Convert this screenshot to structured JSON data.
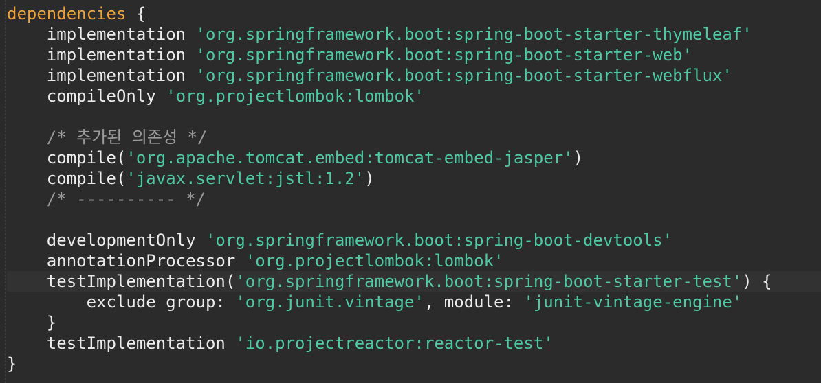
{
  "editor": {
    "language": "groovy",
    "colors": {
      "background": "#2b2b2b",
      "identifier": "#ebebeb",
      "string": "#4ec9a3",
      "comment": "#9a9a9a",
      "keyword": "#f0a23a"
    },
    "lines": [
      {
        "indent": "",
        "tokens": [
          {
            "type": "keyword",
            "text": "dependencies"
          },
          {
            "type": "punct",
            "text": " {"
          }
        ]
      },
      {
        "indent": "    ",
        "tokens": [
          {
            "type": "id",
            "text": "implementation "
          },
          {
            "type": "str",
            "text": "'org.springframework.boot:spring-boot-starter-thymeleaf'"
          }
        ]
      },
      {
        "indent": "    ",
        "tokens": [
          {
            "type": "id",
            "text": "implementation "
          },
          {
            "type": "str",
            "text": "'org.springframework.boot:spring-boot-starter-web'"
          }
        ]
      },
      {
        "indent": "    ",
        "tokens": [
          {
            "type": "id",
            "text": "implementation "
          },
          {
            "type": "str",
            "text": "'org.springframework.boot:spring-boot-starter-webflux'"
          }
        ]
      },
      {
        "indent": "    ",
        "tokens": [
          {
            "type": "id",
            "text": "compileOnly "
          },
          {
            "type": "str",
            "text": "'org.projectlombok:lombok'"
          }
        ]
      },
      {
        "indent": "",
        "tokens": []
      },
      {
        "indent": "    ",
        "tokens": [
          {
            "type": "comment",
            "text": "/* 추가된 의존성 */"
          }
        ]
      },
      {
        "indent": "    ",
        "tokens": [
          {
            "type": "id",
            "text": "compile"
          },
          {
            "type": "punct",
            "text": "("
          },
          {
            "type": "str",
            "text": "'org.apache.tomcat.embed:tomcat-embed-jasper'"
          },
          {
            "type": "punct",
            "text": ")"
          }
        ]
      },
      {
        "indent": "    ",
        "tokens": [
          {
            "type": "id",
            "text": "compile"
          },
          {
            "type": "punct",
            "text": "("
          },
          {
            "type": "str",
            "text": "'javax.servlet:jstl:1.2'"
          },
          {
            "type": "punct",
            "text": ")"
          }
        ]
      },
      {
        "indent": "    ",
        "tokens": [
          {
            "type": "comment",
            "text": "/* ---------- */"
          }
        ]
      },
      {
        "indent": "",
        "tokens": []
      },
      {
        "indent": "    ",
        "tokens": [
          {
            "type": "id",
            "text": "developmentOnly "
          },
          {
            "type": "str",
            "text": "'org.springframework.boot:spring-boot-devtools'"
          }
        ]
      },
      {
        "indent": "    ",
        "tokens": [
          {
            "type": "id",
            "text": "annotationProcessor "
          },
          {
            "type": "str",
            "text": "'org.projectlombok:lombok'"
          }
        ]
      },
      {
        "indent": "    ",
        "current": true,
        "tokens": [
          {
            "type": "id",
            "text": "testImplementation"
          },
          {
            "type": "punct",
            "text": "("
          },
          {
            "type": "str",
            "text": "'org.springframework.boot:spring-boot-starter-test'"
          },
          {
            "type": "punct",
            "text": ") {"
          }
        ]
      },
      {
        "indent": "        ",
        "tokens": [
          {
            "type": "id",
            "text": "exclude group: "
          },
          {
            "type": "str",
            "text": "'org.junit.vintage'"
          },
          {
            "type": "punct",
            "text": ", module: "
          },
          {
            "type": "str",
            "text": "'junit-vintage-engine'"
          }
        ]
      },
      {
        "indent": "    ",
        "tokens": [
          {
            "type": "punct",
            "text": "}"
          }
        ]
      },
      {
        "indent": "    ",
        "tokens": [
          {
            "type": "id",
            "text": "testImplementation "
          },
          {
            "type": "str",
            "text": "'io.projectreactor:reactor-test'"
          }
        ]
      },
      {
        "indent": "",
        "tokens": [
          {
            "type": "punct",
            "text": "}"
          }
        ]
      }
    ]
  }
}
